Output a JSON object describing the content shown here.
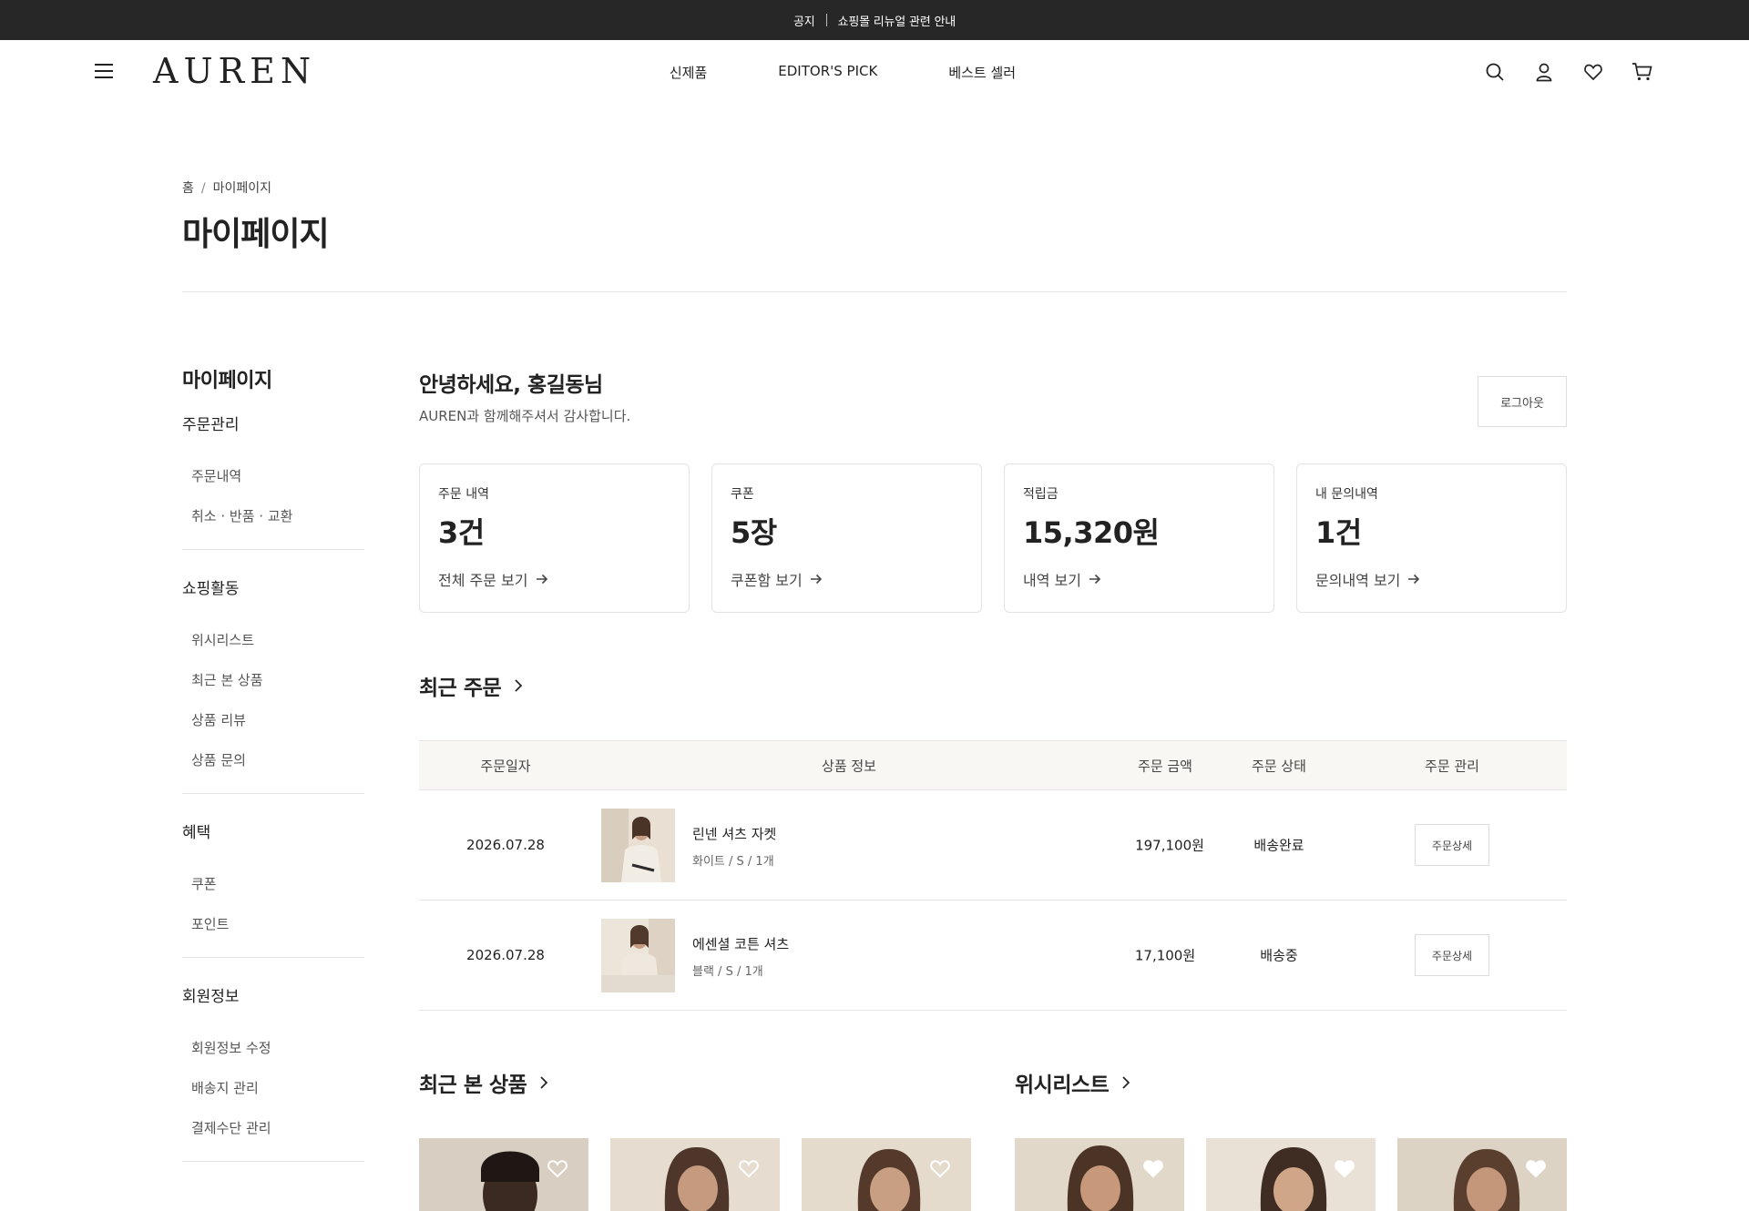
{
  "notice": {
    "label": "공지",
    "text": "쇼핑몰 리뉴얼 관련 안내"
  },
  "header": {
    "logo": "AUREN",
    "nav": [
      "신제품",
      "EDITOR'S PICK",
      "베스트 셀러"
    ]
  },
  "breadcrumb": {
    "home": "홈",
    "sep": "/",
    "current": "마이페이지"
  },
  "page_title": "마이페이지",
  "sidebar": {
    "heading": "마이페이지",
    "groups": [
      {
        "title": "주문관리",
        "items": [
          "주문내역",
          "취소 · 반품 · 교환"
        ]
      },
      {
        "title": "쇼핑활동",
        "items": [
          "위시리스트",
          "최근 본 상품",
          "상품 리뷰",
          "상품 문의"
        ]
      },
      {
        "title": "혜택",
        "items": [
          "쿠폰",
          "포인트"
        ]
      },
      {
        "title": "회원정보",
        "items": [
          "회원정보 수정",
          "배송지 관리",
          "결제수단 관리"
        ]
      }
    ]
  },
  "greeting": {
    "title": "안녕하세요, 홍길동님",
    "subtitle": "AUREN과 함께해주셔서 감사합니다.",
    "logout": "로그아웃"
  },
  "stats": [
    {
      "label": "주문 내역",
      "value": "3건",
      "link": "전체 주문 보기"
    },
    {
      "label": "쿠폰",
      "value": "5장",
      "link": "쿠폰함 보기"
    },
    {
      "label": "적립금",
      "value": "15,320원",
      "link": "내역 보기"
    },
    {
      "label": "내 문의내역",
      "value": "1건",
      "link": "문의내역 보기"
    }
  ],
  "recent_orders": {
    "title": "최근 주문",
    "columns": [
      "주문일자",
      "상품 정보",
      "주문 금액",
      "주문 상태",
      "주문 관리"
    ],
    "rows": [
      {
        "date": "2026.07.28",
        "name": "린넨 셔츠 자켓",
        "option": "화이트 / S / 1개",
        "amount": "197,100원",
        "status": "배송완료",
        "action": "주문상세"
      },
      {
        "date": "2026.07.28",
        "name": "에센셜 코튼 셔츠",
        "option": "블랙 / S / 1개",
        "amount": "17,100원",
        "status": "배송중",
        "action": "주문상세"
      }
    ]
  },
  "recently_viewed": {
    "title": "최근 본 상품"
  },
  "wishlist": {
    "title": "위시리스트"
  },
  "colors": {
    "notice_bg": "#272727",
    "table_head_bg": "#f8f7f4",
    "border": "#e3e3e3"
  }
}
